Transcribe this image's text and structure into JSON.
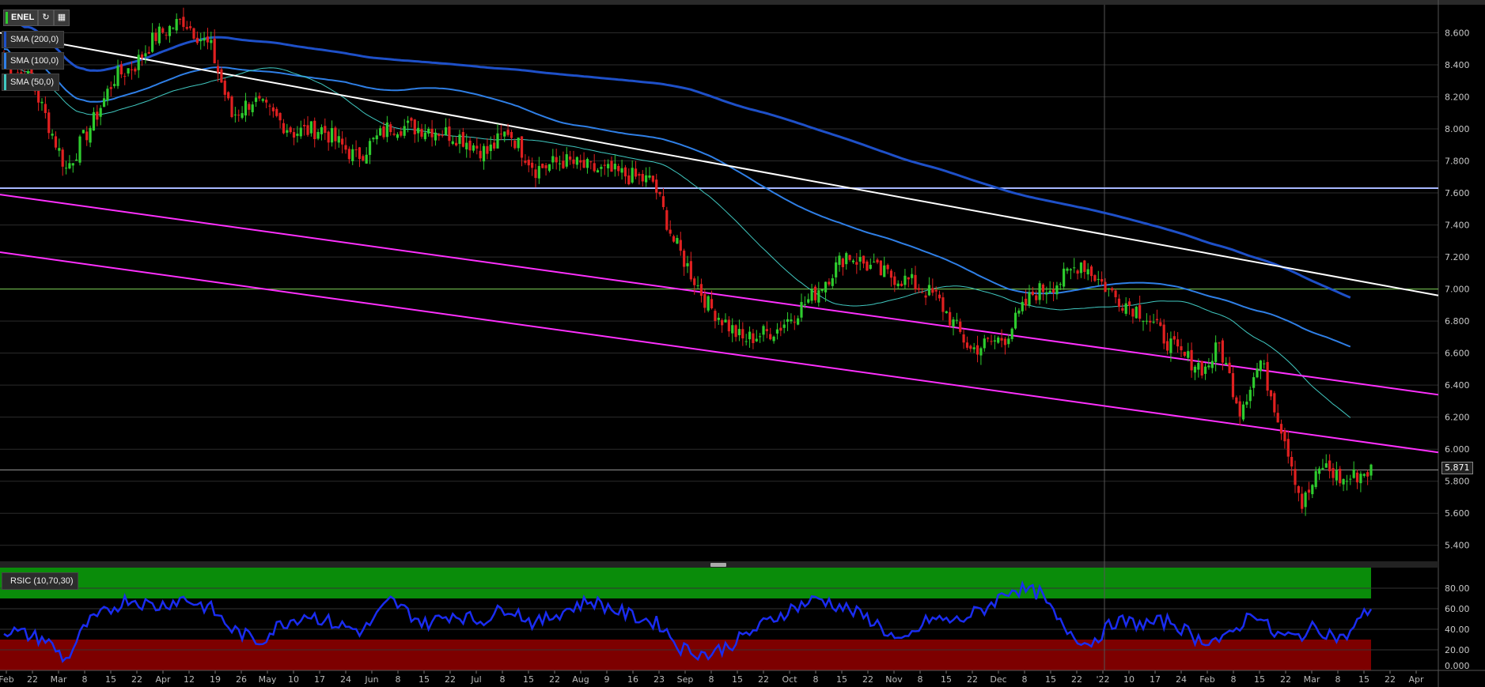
{
  "symbol": "ENEL",
  "last_price": "5.871",
  "toolbar": {
    "refresh_icon": "refresh-icon",
    "calc_icon": "calculator-icon"
  },
  "legend": [
    {
      "label": "SMA (200,0)",
      "color": "#1e50c8"
    },
    {
      "label": "SMA (100,0)",
      "color": "#2f7fe6"
    },
    {
      "label": "SMA (50,0)",
      "color": "#40c8c0"
    }
  ],
  "indicator_label": "RSIC (10,70,30)",
  "colors": {
    "up": "#2ecc2e",
    "down": "#e02020",
    "sma200": "#1e50c8",
    "sma100": "#2f7fe6",
    "sma50": "#40c8c0",
    "trend_white": "#ffffff",
    "channel": "#ff30ff",
    "support": "#a8b8ff",
    "level": "#7acc50",
    "rsi_line": "#1a2cf0",
    "rsi_ob": "#0a8c0a",
    "rsi_os": "#7d0000"
  },
  "chart_data": {
    "type": "candlestick",
    "price_axis": {
      "ticks": [
        "8.600",
        "8.400",
        "8.200",
        "8.000",
        "7.800",
        "7.600",
        "7.400",
        "7.200",
        "7.000",
        "6.800",
        "6.600",
        "6.400",
        "6.200",
        "6.000",
        "5.800",
        "5.600",
        "5.400"
      ],
      "range": [
        5.3,
        8.78
      ]
    },
    "rsi_axis": {
      "ticks": [
        "80.00",
        "60.00",
        "40.00",
        "20.00",
        "0.000"
      ],
      "range": [
        0,
        100
      ],
      "overbought": 70,
      "oversold": 30
    },
    "x_labels": [
      "Feb",
      "22",
      "Mar",
      "8",
      "15",
      "22",
      "Apr",
      "12",
      "19",
      "26",
      "May",
      "10",
      "17",
      "24",
      "Jun",
      "8",
      "15",
      "22",
      "Jul",
      "8",
      "15",
      "22",
      "Aug",
      "9",
      "16",
      "23",
      "Sep",
      "8",
      "15",
      "22",
      "Oct",
      "8",
      "15",
      "22",
      "Nov",
      "8",
      "15",
      "22",
      "Dec",
      "8",
      "15",
      "22",
      "'22",
      "10",
      "17",
      "24",
      "Feb",
      "8",
      "15",
      "22",
      "Mar",
      "8",
      "15",
      "22",
      "Apr"
    ],
    "key_levels": {
      "horizontal_support": 7.63,
      "horizontal_level": 7.0,
      "last_close": 5.871
    },
    "price_path": [
      [
        0,
        8.42
      ],
      [
        8,
        8.3
      ],
      [
        18,
        7.75
      ],
      [
        26,
        8.05
      ],
      [
        32,
        8.32
      ],
      [
        38,
        8.4
      ],
      [
        44,
        8.58
      ],
      [
        52,
        8.68
      ],
      [
        60,
        8.5
      ],
      [
        66,
        8.08
      ],
      [
        72,
        8.18
      ],
      [
        84,
        7.98
      ],
      [
        92,
        8.0
      ],
      [
        102,
        7.82
      ],
      [
        112,
        8.02
      ],
      [
        124,
        8.0
      ],
      [
        132,
        7.95
      ],
      [
        140,
        7.85
      ],
      [
        146,
        7.99
      ],
      [
        154,
        7.75
      ],
      [
        162,
        7.8
      ],
      [
        170,
        7.75
      ],
      [
        178,
        7.72
      ],
      [
        188,
        7.67
      ],
      [
        194,
        7.3
      ],
      [
        204,
        6.9
      ],
      [
        214,
        6.68
      ],
      [
        224,
        6.75
      ],
      [
        234,
        6.95
      ],
      [
        244,
        7.22
      ],
      [
        254,
        7.1
      ],
      [
        262,
        7.05
      ],
      [
        270,
        6.95
      ],
      [
        280,
        6.62
      ],
      [
        290,
        6.7
      ],
      [
        298,
        6.97
      ],
      [
        306,
        7.05
      ],
      [
        312,
        7.17
      ],
      [
        322,
        6.95
      ],
      [
        330,
        6.85
      ],
      [
        340,
        6.6
      ],
      [
        348,
        6.5
      ],
      [
        352,
        6.65
      ],
      [
        358,
        6.25
      ],
      [
        364,
        6.55
      ],
      [
        368,
        6.28
      ],
      [
        372,
        6.0
      ],
      [
        376,
        5.65
      ],
      [
        382,
        5.9
      ],
      [
        388,
        5.8
      ],
      [
        392,
        5.84
      ],
      [
        396,
        5.87
      ]
    ],
    "rsi_path": [
      [
        0,
        40
      ],
      [
        12,
        30
      ],
      [
        18,
        10
      ],
      [
        24,
        45
      ],
      [
        36,
        70
      ],
      [
        44,
        62
      ],
      [
        52,
        70
      ],
      [
        60,
        60
      ],
      [
        66,
        40
      ],
      [
        74,
        28
      ],
      [
        80,
        45
      ],
      [
        88,
        55
      ],
      [
        96,
        45
      ],
      [
        104,
        38
      ],
      [
        112,
        68
      ],
      [
        122,
        45
      ],
      [
        130,
        55
      ],
      [
        138,
        48
      ],
      [
        146,
        62
      ],
      [
        154,
        45
      ],
      [
        162,
        58
      ],
      [
        170,
        68
      ],
      [
        180,
        55
      ],
      [
        190,
        45
      ],
      [
        196,
        22
      ],
      [
        204,
        15
      ],
      [
        212,
        28
      ],
      [
        220,
        45
      ],
      [
        228,
        60
      ],
      [
        236,
        70
      ],
      [
        244,
        60
      ],
      [
        252,
        48
      ],
      [
        260,
        25
      ],
      [
        268,
        50
      ],
      [
        276,
        48
      ],
      [
        284,
        60
      ],
      [
        292,
        80
      ],
      [
        300,
        75
      ],
      [
        306,
        45
      ],
      [
        314,
        25
      ],
      [
        322,
        48
      ],
      [
        330,
        45
      ],
      [
        338,
        48
      ],
      [
        346,
        30
      ],
      [
        354,
        30
      ],
      [
        362,
        58
      ],
      [
        368,
        35
      ],
      [
        374,
        32
      ],
      [
        380,
        42
      ],
      [
        388,
        30
      ],
      [
        396,
        62
      ]
    ]
  }
}
